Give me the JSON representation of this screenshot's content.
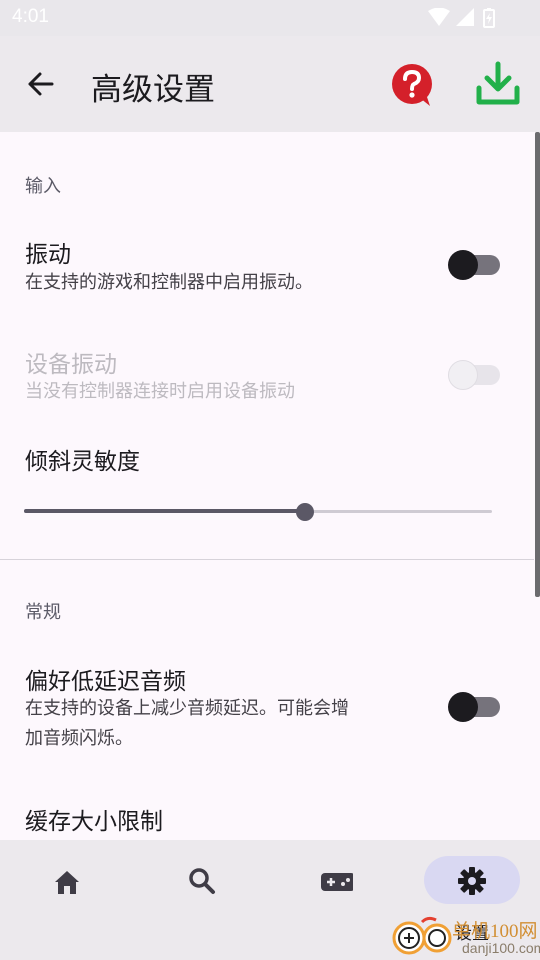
{
  "status_bar": {
    "time": "4:01"
  },
  "app_bar": {
    "title": "高级设置"
  },
  "sections": {
    "input": {
      "header": "输入",
      "vibration": {
        "title": "振动",
        "summary": "在支持的游戏和控制器中启用振动。",
        "enabled": false
      },
      "device_vibration": {
        "title": "设备振动",
        "summary": "当没有控制器连接时启用设备振动",
        "enabled": false,
        "disabled": true
      },
      "tilt_sensitivity": {
        "title": "倾斜灵敏度",
        "value_fraction": 0.6
      }
    },
    "general": {
      "header": "常规",
      "low_latency_audio": {
        "title": "偏好低延迟音频",
        "summary_line1": "在支持的设备上减少音频延迟。可能会增",
        "summary_line2": "加音频闪烁。",
        "enabled": false
      },
      "cache_size": {
        "title": "缓存大小限制"
      }
    }
  },
  "bottom_nav": {
    "items": [
      {
        "icon": "home-icon",
        "label": ""
      },
      {
        "icon": "search-icon",
        "label": ""
      },
      {
        "icon": "gamepad-icon",
        "label": ""
      },
      {
        "icon": "gear-icon",
        "label": "设置",
        "active": true
      }
    ]
  },
  "watermark": {
    "main": "单机100网",
    "sub": "danji100.com"
  },
  "colors": {
    "help_red": "#d4202a",
    "download_green": "#22b04a",
    "nav_active": "#d9d8f2"
  }
}
